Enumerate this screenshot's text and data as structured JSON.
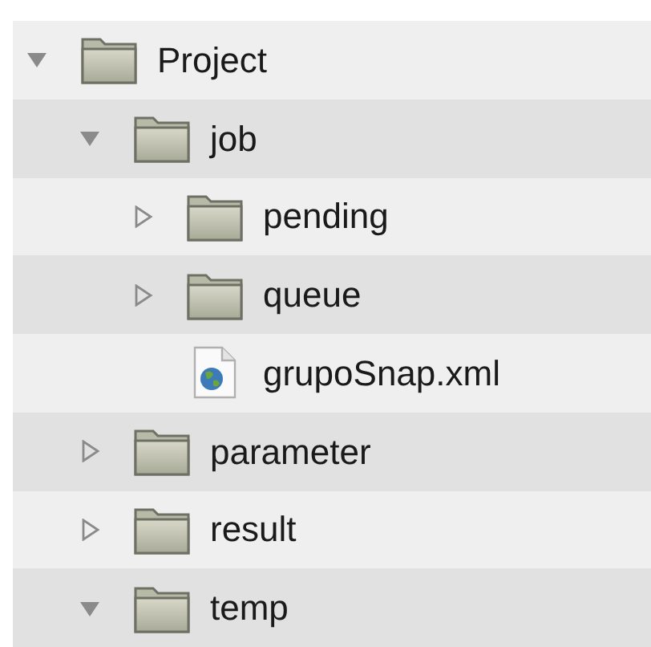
{
  "tree": [
    {
      "kind": "folder",
      "label": "Project",
      "expanded": true,
      "children": [
        {
          "kind": "folder",
          "label": "job",
          "expanded": true,
          "children": [
            {
              "kind": "folder",
              "label": "pending",
              "expanded": false
            },
            {
              "kind": "folder",
              "label": "queue",
              "expanded": false
            },
            {
              "kind": "file",
              "label": "grupoSnap.xml"
            }
          ]
        },
        {
          "kind": "folder",
          "label": "parameter",
          "expanded": false
        },
        {
          "kind": "folder",
          "label": "result",
          "expanded": false
        },
        {
          "kind": "folder",
          "label": "temp",
          "expanded": true
        }
      ]
    }
  ]
}
